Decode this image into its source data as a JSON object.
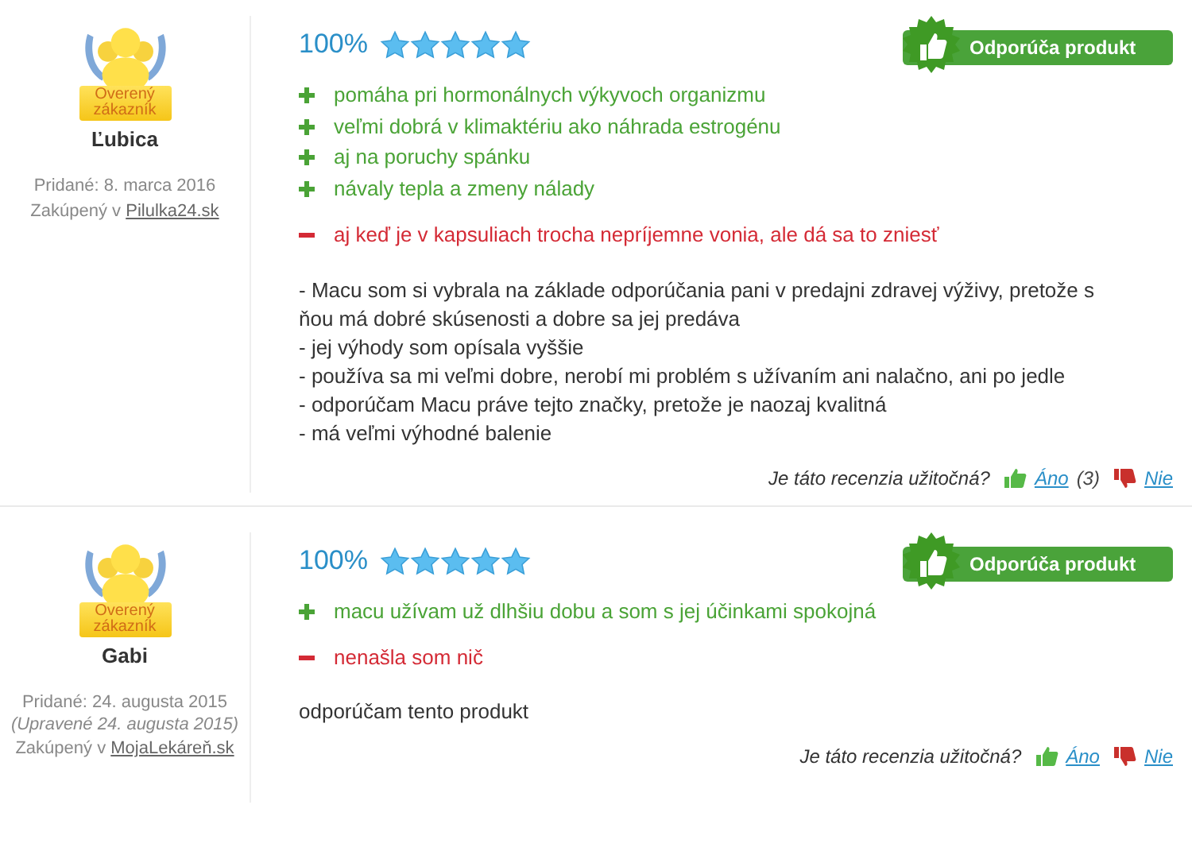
{
  "reviews": [
    {
      "badge": [
        "Overený",
        "zákazník"
      ],
      "name": "Ľubica",
      "added": "Pridané: 8. marca 2016",
      "purchased_prefix": "Zakúpený v",
      "shop": "Pilulka24.sk",
      "percent": "100%",
      "stars": 5,
      "recommend": "Odporúča produkt",
      "pros": [
        "pomáha pri hormonálnych výkyvoch organizmu",
        "veľmi dobrá v klimaktériu ako náhrada estrogénu",
        "aj na poruchy spánku",
        "návaly tepla a zmeny nálady"
      ],
      "cons": [
        "aj keď je v kapsuliach trocha nepríjemne vonia, ale dá sa to zniesť"
      ],
      "body": [
        "- Macu som si vybrala na základe odporúčania pani v predajni zdravej výživy, pretože s ňou má dobré skúsenosti a dobre sa jej predáva",
        "- jej výhody som opísala vyššie",
        "- používa sa mi veľmi dobre, nerobí mi problém s užívaním ani nalačno, ani po jedle",
        "- odporúčam Macu práve tejto značky, pretože je naozaj kvalitná",
        "- má veľmi výhodné balenie"
      ],
      "helpful": "Je táto recenzia užitočná?",
      "yes": "Áno",
      "yes_count": "(3)",
      "no": "Nie"
    },
    {
      "badge": [
        "Overený",
        "zákazník"
      ],
      "name": "Gabi",
      "added": "Pridané: 24. augusta 2015",
      "edited": "(Upravené 24. augusta 2015)",
      "purchased_prefix": "Zakúpený v",
      "shop": "MojaLekáreň.sk",
      "percent": "100%",
      "stars": 5,
      "recommend": "Odporúča produkt",
      "pros": [
        "macu užívam už dlhšiu dobu a som s jej účinkami spokojná"
      ],
      "cons": [
        "nenašla som nič"
      ],
      "body": [
        "odporúčam tento produkt"
      ],
      "helpful": "Je táto recenzia užitočná?",
      "yes": "Áno",
      "no": "Nie"
    }
  ]
}
